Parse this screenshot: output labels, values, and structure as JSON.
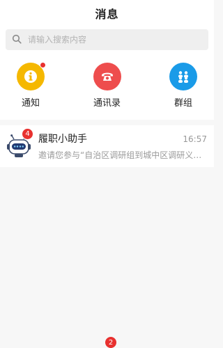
{
  "header": {
    "title": "消息"
  },
  "search": {
    "placeholder": "请输入搜索内容",
    "icon": "search-icon"
  },
  "quick_actions": [
    {
      "label": "通知",
      "icon": "notice-icon",
      "color": "#f5b800",
      "has_dot": true
    },
    {
      "label": "通讯录",
      "icon": "phone-icon",
      "color": "#ee4d4d",
      "has_dot": false
    },
    {
      "label": "群组",
      "icon": "group-icon",
      "color": "#1a9be8",
      "has_dot": false
    }
  ],
  "conversations": [
    {
      "name": "履职小助手",
      "time": "16:57",
      "preview": "邀请您参与“自治区调研组到城中区调研义务教育工作”",
      "unread": "4",
      "avatar": "robot-avatar-icon"
    }
  ],
  "tabbar": {
    "badge": "2"
  }
}
